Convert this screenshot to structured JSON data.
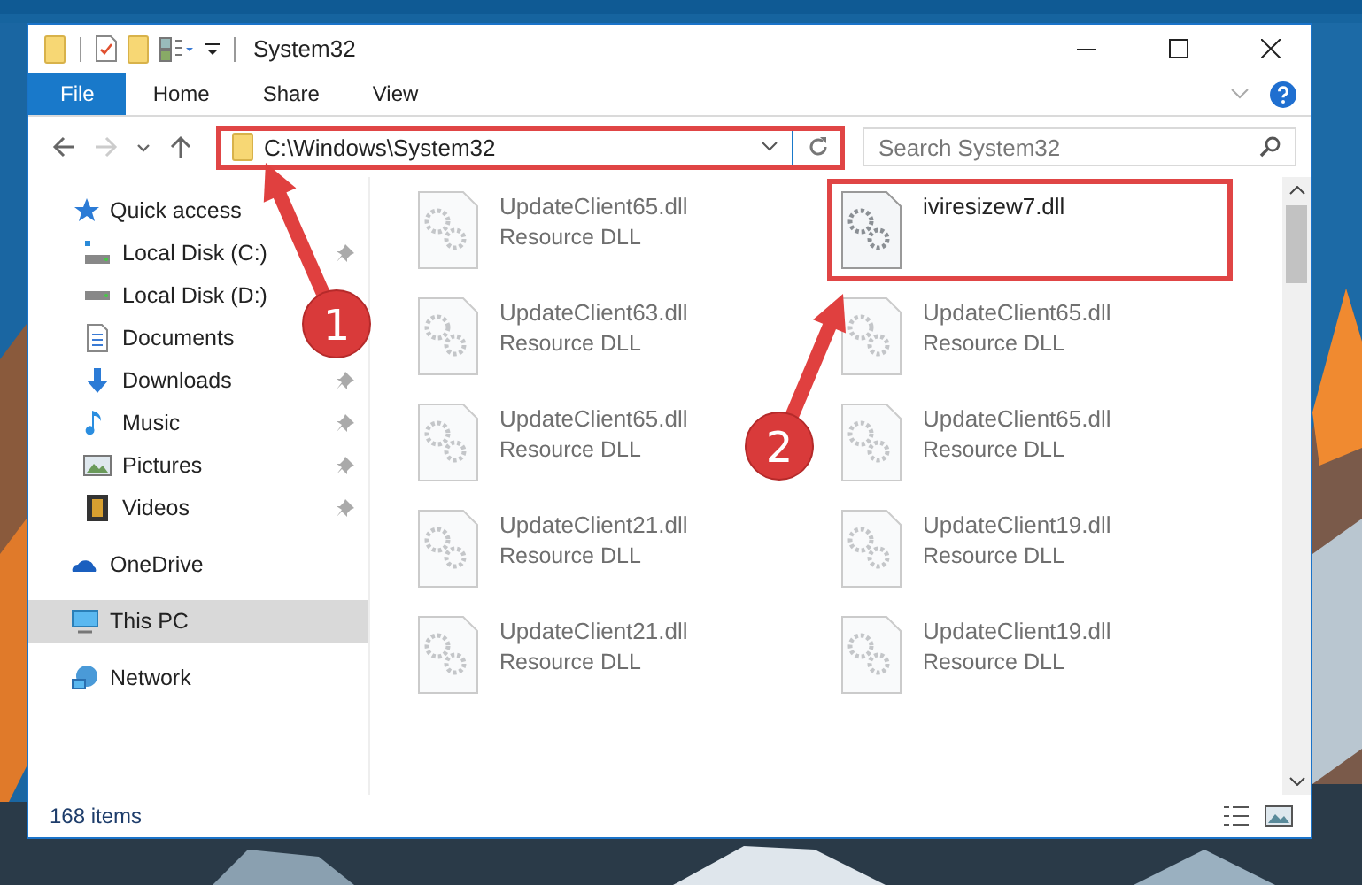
{
  "window": {
    "title": "System32"
  },
  "ribbon_tabs": [
    {
      "label": "File",
      "selected": true
    },
    {
      "label": "Home",
      "selected": false
    },
    {
      "label": "Share",
      "selected": false
    },
    {
      "label": "View",
      "selected": false
    }
  ],
  "nav": [
    {
      "kind": "back",
      "disabled": false
    },
    {
      "kind": "forward",
      "disabled": true
    },
    {
      "kind": "recent",
      "disabled": false
    },
    {
      "kind": "up",
      "disabled": false
    }
  ],
  "address": {
    "path": "C:\\Windows\\System32",
    "highlighted": true
  },
  "search": {
    "placeholder": "Search System32"
  },
  "sidebar": {
    "items": [
      {
        "label": "Quick access",
        "selected": false,
        "children": [
          {
            "label": "Local Disk (C:)",
            "pinned": true
          },
          {
            "label": "Local Disk (D:)",
            "pinned": false
          },
          {
            "label": "Documents",
            "pinned": false
          },
          {
            "label": "Downloads",
            "pinned": true
          },
          {
            "label": "Music",
            "pinned": true
          },
          {
            "label": "Pictures",
            "pinned": true
          },
          {
            "label": "Videos",
            "pinned": true
          }
        ]
      },
      {
        "label": "OneDrive",
        "selected": false
      },
      {
        "label": "This PC",
        "selected": true
      },
      {
        "label": "Network",
        "selected": false
      }
    ]
  },
  "files": [
    {
      "name": "UpdateClient65.dll",
      "type": "Resource DLL",
      "blurred": true,
      "highlighted": false
    },
    {
      "name": "iviresizew7.dll",
      "blurred": false,
      "highlighted": true
    },
    {
      "name": "UpdateClient63.dll",
      "type": "Resource DLL",
      "blurred": true,
      "highlighted": false
    },
    {
      "name": "UpdateClient65.dll",
      "type": "Resource DLL",
      "blurred": true,
      "highlighted": false
    },
    {
      "name": "UpdateClient65.dll",
      "type": "Resource DLL",
      "blurred": true,
      "highlighted": false
    },
    {
      "name": "UpdateClient65.dll",
      "type": "Resource DLL",
      "blurred": true,
      "highlighted": false
    },
    {
      "name": "UpdateClient21.dll",
      "type": "Resource DLL",
      "blurred": true,
      "highlighted": false
    },
    {
      "name": "UpdateClient19.dll",
      "type": "Resource DLL",
      "blurred": true,
      "highlighted": false
    },
    {
      "name": "UpdateClient21.dll",
      "type": "Resource DLL",
      "blurred": true,
      "highlighted": false
    },
    {
      "name": "UpdateClient19.dll",
      "type": "Resource DLL",
      "blurred": true,
      "highlighted": false
    }
  ],
  "status_bar": {
    "item_count": "168 items"
  },
  "annotations": [
    {
      "number": "1"
    },
    {
      "number": "2"
    }
  ]
}
